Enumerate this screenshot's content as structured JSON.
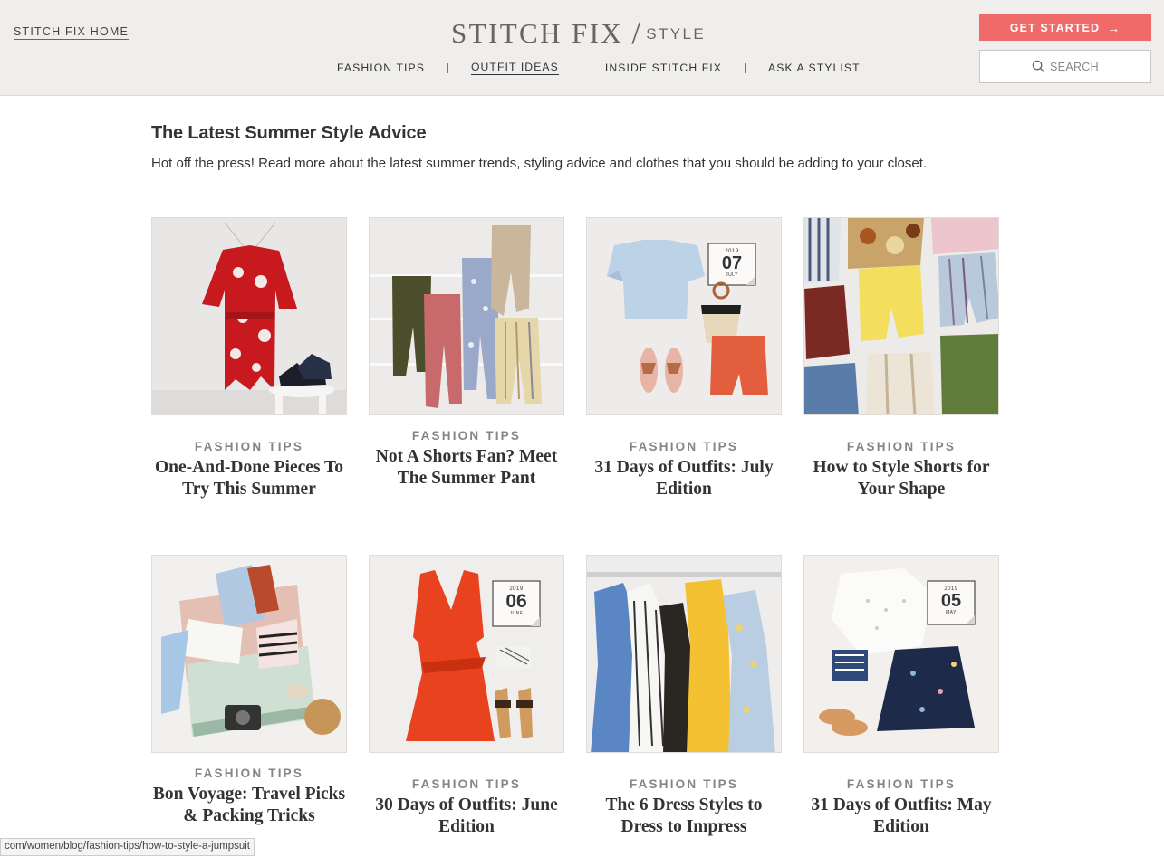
{
  "header": {
    "home_link": "STITCH FIX HOME",
    "logo_main": "STITCH FIX",
    "logo_slash": "/",
    "logo_sub": "STYLE",
    "nav": [
      {
        "label": "FASHION TIPS",
        "active": false
      },
      {
        "label": "OUTFIT IDEAS",
        "active": true
      },
      {
        "label": "INSIDE STITCH FIX",
        "active": false
      },
      {
        "label": "ASK A STYLIST",
        "active": false
      }
    ],
    "get_started_label": "GET STARTED",
    "search_label": "SEARCH"
  },
  "intro": {
    "title": "The Latest Summer Style Advice",
    "text": "Hot off the press! Read more about the latest summer trends, styling advice and clothes that you should be adding to your closet."
  },
  "cards": [
    {
      "category": "FASHION TIPS",
      "title": "One-And-Done Pieces To Try This Summer"
    },
    {
      "category": "FASHION TIPS",
      "title": "Not A Shorts Fan? Meet The Summer Pant"
    },
    {
      "category": "FASHION TIPS",
      "title": "31 Days of Outfits: July Edition",
      "calendar": {
        "year": "2019",
        "day": "07",
        "month": "JULY"
      }
    },
    {
      "category": "FASHION TIPS",
      "title": "How to Style Shorts for Your Shape"
    },
    {
      "category": "FASHION TIPS",
      "title": "Bon Voyage: Travel Picks & Packing Tricks"
    },
    {
      "category": "FASHION TIPS",
      "title": "30 Days of Outfits: June Edition",
      "calendar": {
        "year": "2019",
        "day": "06",
        "month": "JUNE"
      }
    },
    {
      "category": "FASHION TIPS",
      "title": "The 6 Dress Styles to Dress to Impress"
    },
    {
      "category": "FASHION TIPS",
      "title": "31 Days of Outfits: May Edition",
      "calendar": {
        "year": "2019",
        "day": "05",
        "month": "MAY"
      }
    }
  ],
  "status_url": "com/women/blog/fashion-tips/how-to-style-a-jumpsuit"
}
